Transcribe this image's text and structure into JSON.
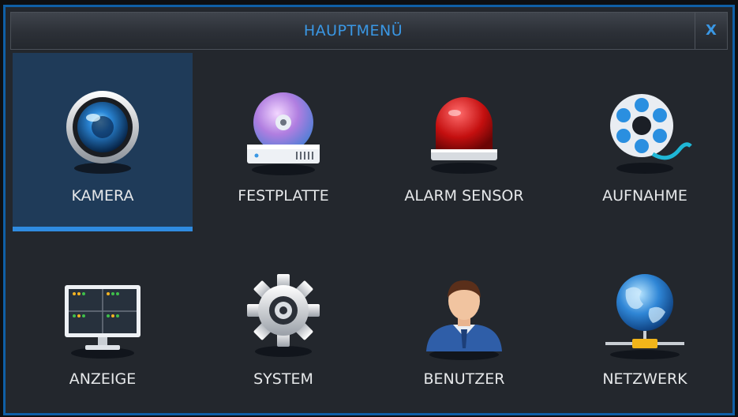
{
  "window": {
    "title": "HAUPTMENÜ",
    "close_label": "X"
  },
  "menu": {
    "items": [
      {
        "label": "KAMERA",
        "icon": "camera-icon",
        "selected": true
      },
      {
        "label": "FESTPLATTE",
        "icon": "hard-disk-icon",
        "selected": false
      },
      {
        "label": "ALARM SENSOR",
        "icon": "alarm-light-icon",
        "selected": false
      },
      {
        "label": "AUFNAHME",
        "icon": "film-reel-icon",
        "selected": false
      },
      {
        "label": "ANZEIGE",
        "icon": "monitor-icon",
        "selected": false
      },
      {
        "label": "SYSTEM",
        "icon": "gear-icon",
        "selected": false
      },
      {
        "label": "BENUTZER",
        "icon": "user-icon",
        "selected": false
      },
      {
        "label": "NETZWERK",
        "icon": "globe-network-icon",
        "selected": false
      }
    ]
  },
  "colors": {
    "accent": "#3a97e4",
    "selected_bg": "#1f3b59",
    "window_bg": "#23272d",
    "border": "#0f5fa6"
  }
}
